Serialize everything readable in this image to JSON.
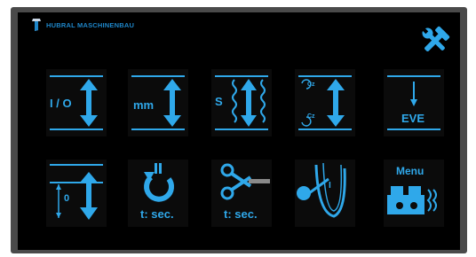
{
  "header": {
    "brand": "HUBRAL MASCHINENBAU"
  },
  "colors": {
    "accent": "#2fa8ea",
    "brand": "#1e86c9",
    "background": "#000000",
    "bezel": "#4a4a4a"
  },
  "icons": {
    "settings": "tools-icon",
    "timer_return": "counterclockwise-arrow-icon",
    "cut": "scissors-icon",
    "bend": "bend-gauge-icon",
    "menu": "machine-icon"
  },
  "grid": {
    "row1": [
      {
        "label": "I / O"
      },
      {
        "label": "mm"
      },
      {
        "label": "S"
      },
      {
        "top": "Cz",
        "bottom": "Cz"
      },
      {
        "label": "EVE"
      }
    ],
    "row2": [
      {
        "label": "0"
      },
      {
        "label": "t: sec."
      },
      {
        "label": "t: sec."
      },
      {
        "label": "I"
      },
      {
        "label": "Menu"
      }
    ]
  }
}
